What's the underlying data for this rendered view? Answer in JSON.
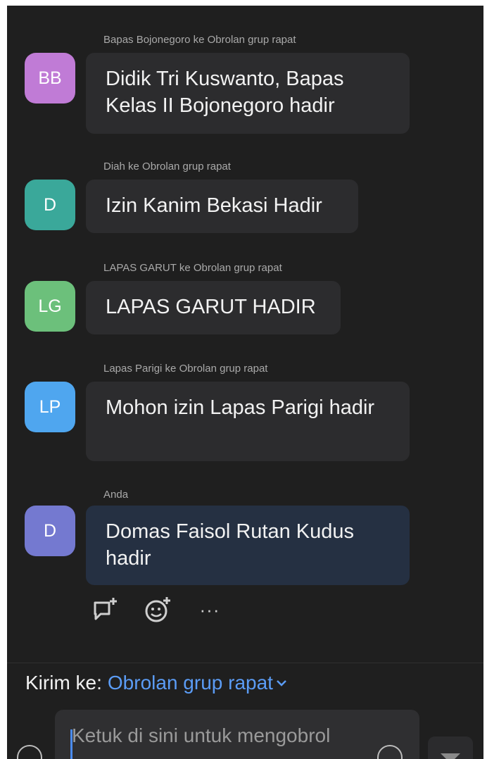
{
  "messages": [
    {
      "sender_line": "Bapas Bojonegoro ke Obrolan grup rapat",
      "avatar_initials": "BB",
      "avatar_color": "#c07bd6",
      "text": "Didik Tri Kuswanto, Bapas Kelas II Bojonegoro hadir"
    },
    {
      "sender_line": "Diah ke Obrolan grup rapat",
      "avatar_initials": "D",
      "avatar_color": "#3aa89a",
      "text": "Izin Kanim Bekasi Hadir"
    },
    {
      "sender_line": "LAPAS GARUT ke Obrolan grup rapat",
      "avatar_initials": "LG",
      "avatar_color": "#6cc07b",
      "text": "LAPAS GARUT HADIR"
    },
    {
      "sender_line": "Lapas Parigi ke Obrolan grup rapat",
      "avatar_initials": "LP",
      "avatar_color": "#4fa6ef",
      "text": "Mohon izin Lapas Parigi hadir"
    },
    {
      "sender_line": "Anda",
      "avatar_initials": "D",
      "avatar_color": "#7479d0",
      "text": "Domas Faisol Rutan Kudus hadir"
    }
  ],
  "reactions": [
    {
      "icon": "reply-comment-icon"
    },
    {
      "icon": "add-reaction-icon"
    },
    {
      "icon": "more-options-icon",
      "glyph": "···"
    }
  ],
  "composer": {
    "send_to_label": "Kirim ke:",
    "send_to_target": "Obrolan grup rapat",
    "placeholder": "Ketuk di sini untuk mengobrol"
  },
  "colors": {
    "background": "#1f1f1f",
    "bubble": "#2c2c2e",
    "own_bubble": "#253042",
    "accent": "#5b9cf5"
  }
}
